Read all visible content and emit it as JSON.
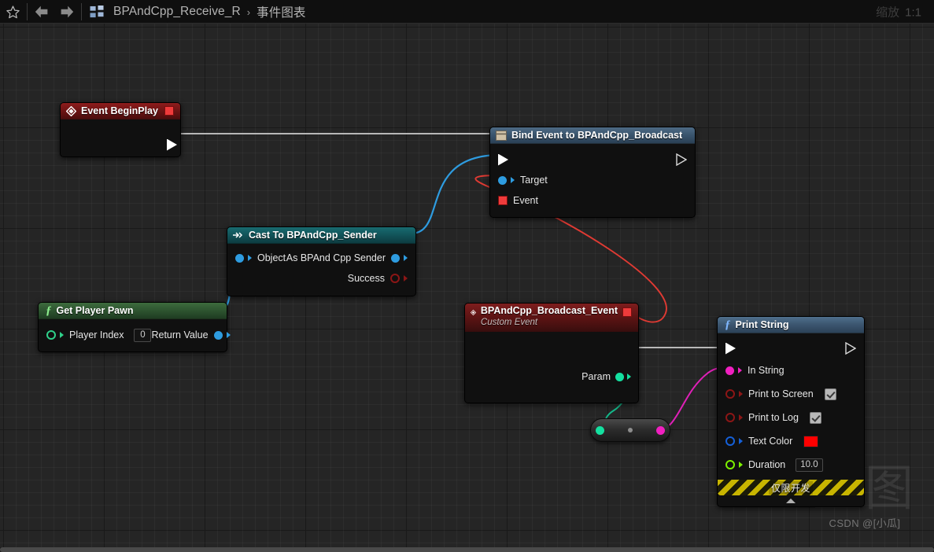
{
  "toolbar": {
    "favorite_icon": "star-icon",
    "back_icon": "arrow-left-icon",
    "forward_icon": "arrow-right-icon",
    "blueprint_icon": "blueprint-grid-icon",
    "breadcrumb": {
      "root": "BPAndCpp_Receive_R",
      "separator": "›",
      "current": "事件图表"
    },
    "zoom_label": "缩放",
    "zoom_value": "1:1"
  },
  "watermark": {
    "big": "蓝图",
    "small": "CSDN @[小瓜]"
  },
  "colors": {
    "exec_white": "#ffffff",
    "object_blue": "#2e9ce0",
    "delegate_red": "#ef3b3b",
    "bool_red": "#8c1616",
    "string_magenta": "#f020c0",
    "struct_blue": "#1560d8",
    "float_green": "#7cf000",
    "param_green": "#14e0a0",
    "wire_blue": "#2e9ce0",
    "wire_red": "#e03a33",
    "wire_white": "#cccccc",
    "wire_green": "#14b88a",
    "wire_magenta": "#e020b8",
    "text_color_swatch": "#ff0000"
  },
  "nodes": {
    "event_begin_play": {
      "title": "Event BeginPlay",
      "icon": "event-diamond-icon",
      "delegate_pin": "delegate-output-pin",
      "exec_out": "exec-output-pin"
    },
    "bind_event": {
      "title": "Bind Event to BPAndCpp_Broadcast",
      "icon": "bind-event-icon",
      "exec_in": "exec-input-pin",
      "exec_out": "exec-output-pin",
      "pins": [
        {
          "label": "Target",
          "type": "object"
        },
        {
          "label": "Event",
          "type": "delegate"
        }
      ]
    },
    "cast_node": {
      "title": "Cast To BPAndCpp_Sender",
      "icon": "cast-arrow-icon",
      "input_label": "Object",
      "outputs": [
        {
          "label": "As BPAnd Cpp Sender",
          "type": "object"
        },
        {
          "label": "Success",
          "type": "bool"
        }
      ]
    },
    "get_player_pawn": {
      "title": "Get Player Pawn",
      "icon": "function-f-icon",
      "input_label": "Player Index",
      "input_value": "0",
      "output_label": "Return Value"
    },
    "custom_event": {
      "title": "BPAndCpp_Broadcast_Event",
      "subtitle": "Custom Event",
      "icon": "event-diamond-icon",
      "delegate_pin": "delegate-output-pin",
      "exec_out": "exec-output-pin",
      "output_label": "Param"
    },
    "print_string": {
      "title": "Print String",
      "icon": "function-f-icon",
      "exec_in": "exec-input-pin",
      "exec_out": "exec-output-pin",
      "pins": [
        {
          "label": "In String",
          "type": "string",
          "value": ""
        },
        {
          "label": "Print to Screen",
          "type": "bool",
          "value": "checked"
        },
        {
          "label": "Print to Log",
          "type": "bool",
          "value": "checked"
        },
        {
          "label": "Text Color",
          "type": "struct",
          "value": "#ff0000"
        },
        {
          "label": "Duration",
          "type": "float",
          "value": "10.0"
        }
      ],
      "dev_only_label": "仅限开发",
      "collapse_icon": "collapse-up-arrow-icon"
    },
    "reroute_knot": {
      "icon": "conversion-node",
      "in_pin": "param-input-pin",
      "out_pin": "string-output-pin"
    }
  }
}
